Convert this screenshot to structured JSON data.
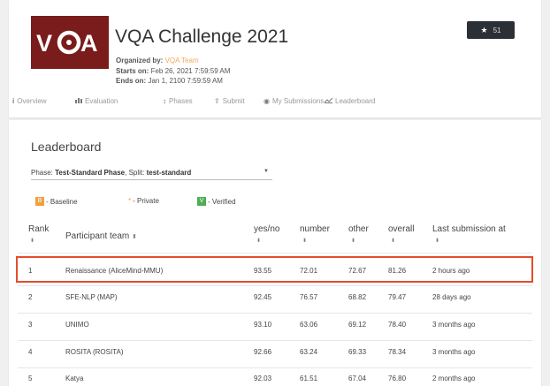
{
  "challenge": {
    "logo_text": "VQA",
    "title": "VQA Challenge 2021",
    "organized_label": "Organized by:",
    "organizer": "VQA Team",
    "starts_label": "Starts on:",
    "starts": "Feb 26, 2021 7:59:59 AM",
    "ends_label": "Ends on:",
    "ends": "Jan 1, 2100 7:59:59 AM",
    "star_count": "51"
  },
  "tabs": [
    {
      "label": "Overview",
      "icon": "info-icon"
    },
    {
      "label": "Evaluation",
      "icon": "bar-chart-icon"
    },
    {
      "label": "Phases",
      "icon": "phases-icon"
    },
    {
      "label": "Submit",
      "icon": "upload-icon"
    },
    {
      "label": "My Submissions",
      "icon": "eye-icon"
    },
    {
      "label": "Leaderboard",
      "icon": "line-chart-icon"
    }
  ],
  "leaderboard": {
    "title": "Leaderboard",
    "phase_label": "Phase:",
    "phase_value": "Test-Standard Phase",
    "split_label": ", Split:",
    "split_value": "test-standard",
    "legend": {
      "baseline_badge": "B",
      "baseline_label": "- Baseline",
      "private_label": "- Private",
      "verified_badge": "V",
      "verified_label": "- Verified"
    },
    "columns": {
      "rank": "Rank",
      "team": "Participant team",
      "yesno": "yes/no",
      "number": "number",
      "other": "other",
      "overall": "overall",
      "last": "Last submission at"
    },
    "rows": [
      {
        "rank": "1",
        "team": "Renaissance (AliceMind-MMU)",
        "yesno": "93.55",
        "number": "72.01",
        "other": "72.67",
        "overall": "81.26",
        "last": "2 hours ago"
      },
      {
        "rank": "2",
        "team": "SFE-NLP (MAP)",
        "yesno": "92.45",
        "number": "76.57",
        "other": "68.82",
        "overall": "79.47",
        "last": "28 days ago"
      },
      {
        "rank": "3",
        "team": "UNIMO",
        "yesno": "93.10",
        "number": "63.06",
        "other": "69.12",
        "overall": "78.40",
        "last": "3 months ago"
      },
      {
        "rank": "4",
        "team": "ROSITA (ROSITA)",
        "yesno": "92.66",
        "number": "63.24",
        "other": "69.33",
        "overall": "78.34",
        "last": "3 months ago"
      },
      {
        "rank": "5",
        "team": "Katya",
        "yesno": "92.03",
        "number": "61.51",
        "other": "67.04",
        "overall": "76.80",
        "last": "2 months ago"
      }
    ]
  },
  "colors": {
    "logo_bg": "#7a1c1c",
    "highlight_border": "#e44c2c",
    "organizer_link": "#f0a85b",
    "baseline": "#f0a040",
    "verified": "#4caf50"
  }
}
